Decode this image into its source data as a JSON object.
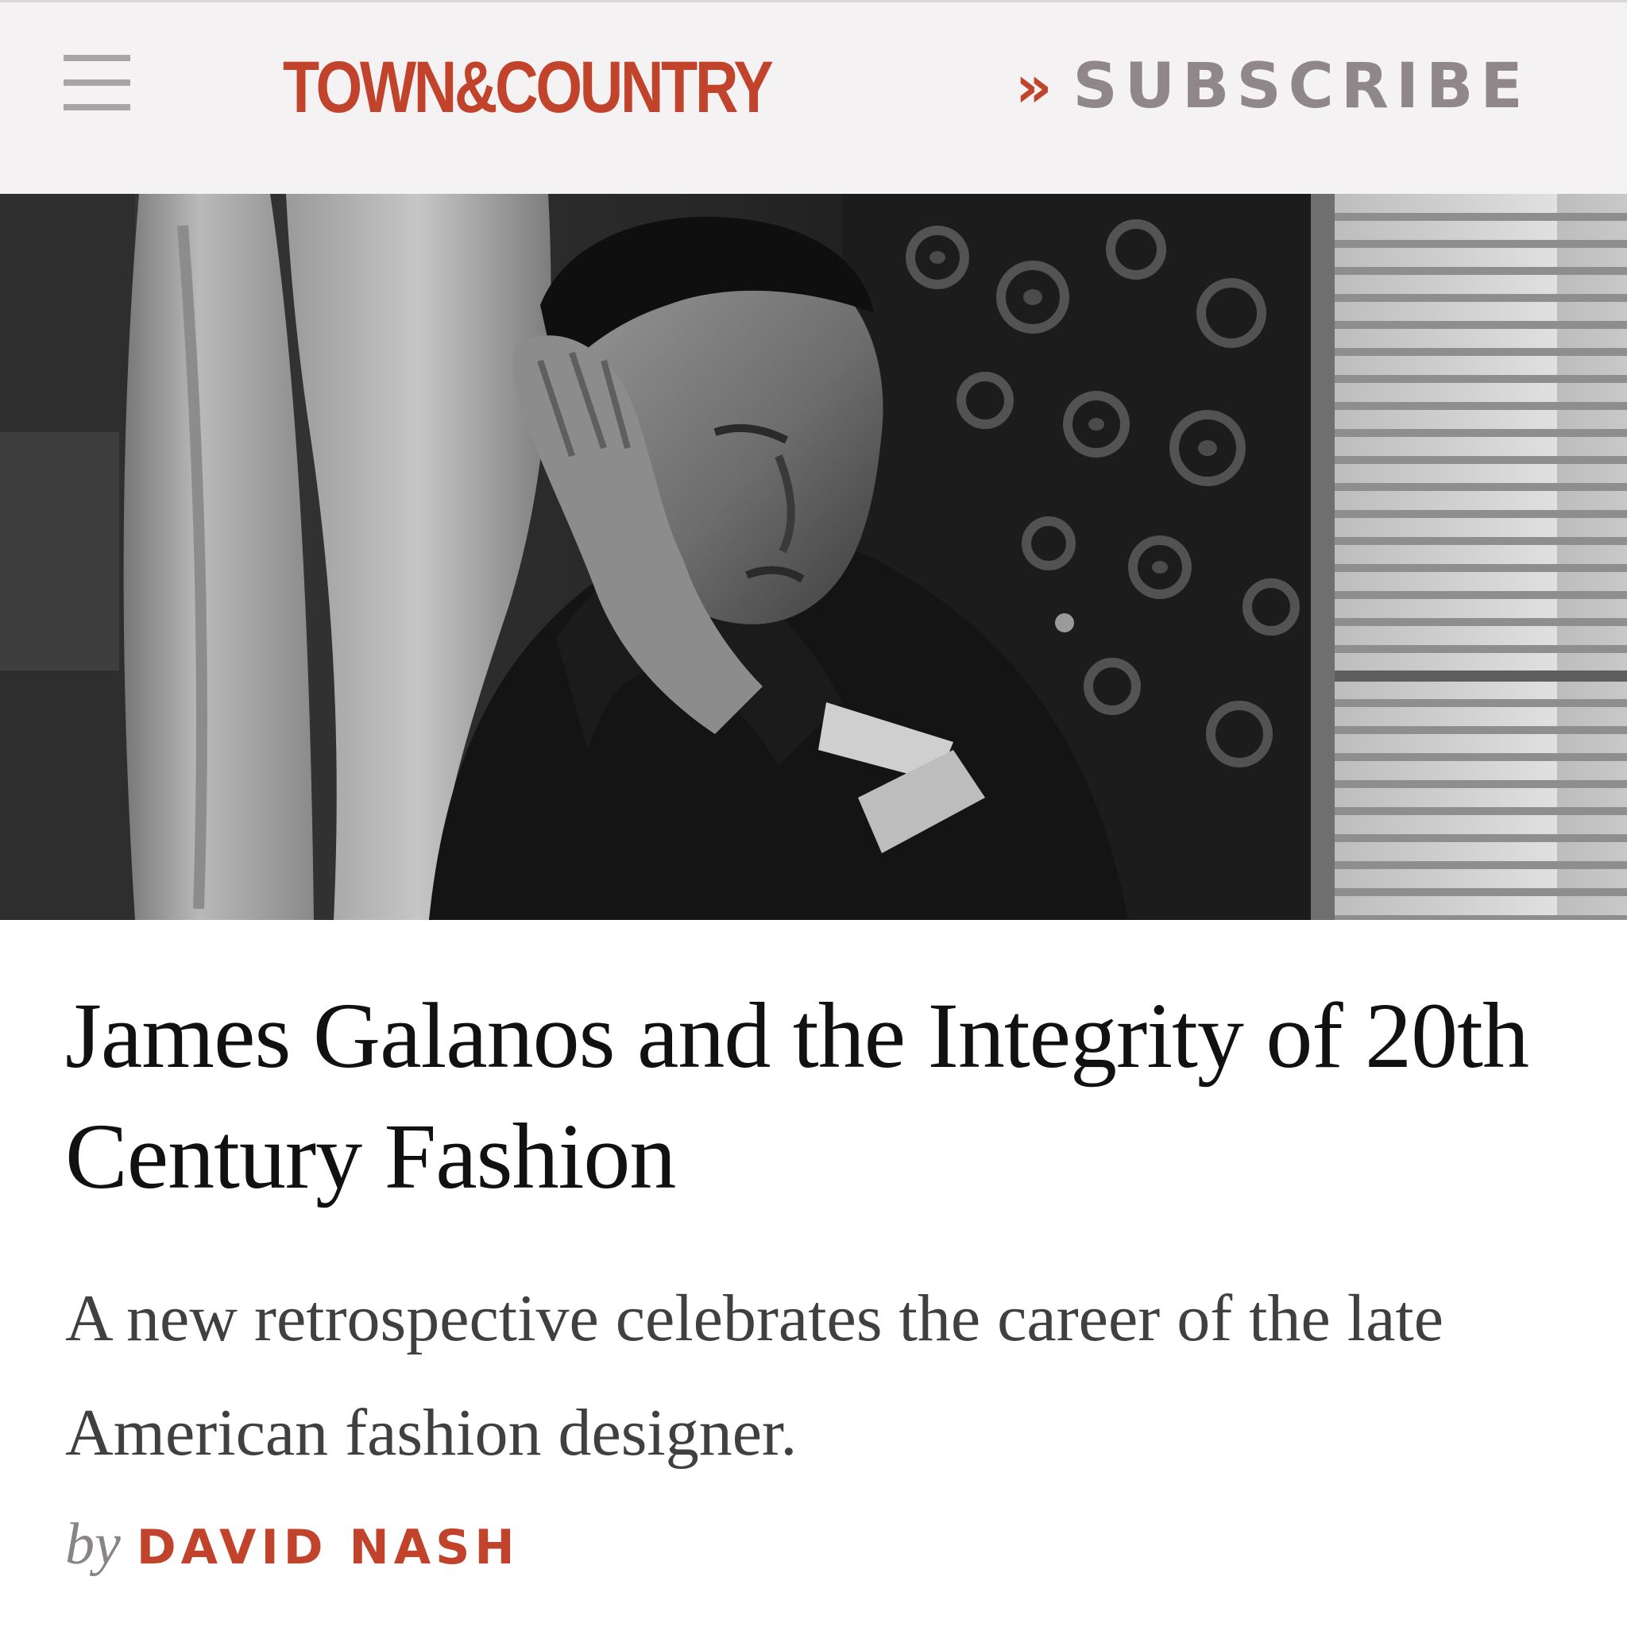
{
  "header": {
    "logo_text": "TOWN&COUNTRY",
    "subscribe_chevron": "»",
    "subscribe_label": "SUBSCRIBE",
    "menu_icon": "hamburger-menu-icon"
  },
  "hero": {
    "description_icon": "black-and-white-portrait-photo"
  },
  "article": {
    "headline": "James Galanos and the Integrity of 20th Century Fashion",
    "dek": "A new retrospective celebrates the career of the late American fashion designer.",
    "byline_prefix": "by",
    "author": "DAVID NASH"
  },
  "colors": {
    "accent": "#c1432b",
    "header_bg": "#f4f2f3",
    "subscribe_text": "#8f8789",
    "menu_icon": "#a9a4a6",
    "headline_text": "#111111",
    "dek_text": "#404040"
  }
}
